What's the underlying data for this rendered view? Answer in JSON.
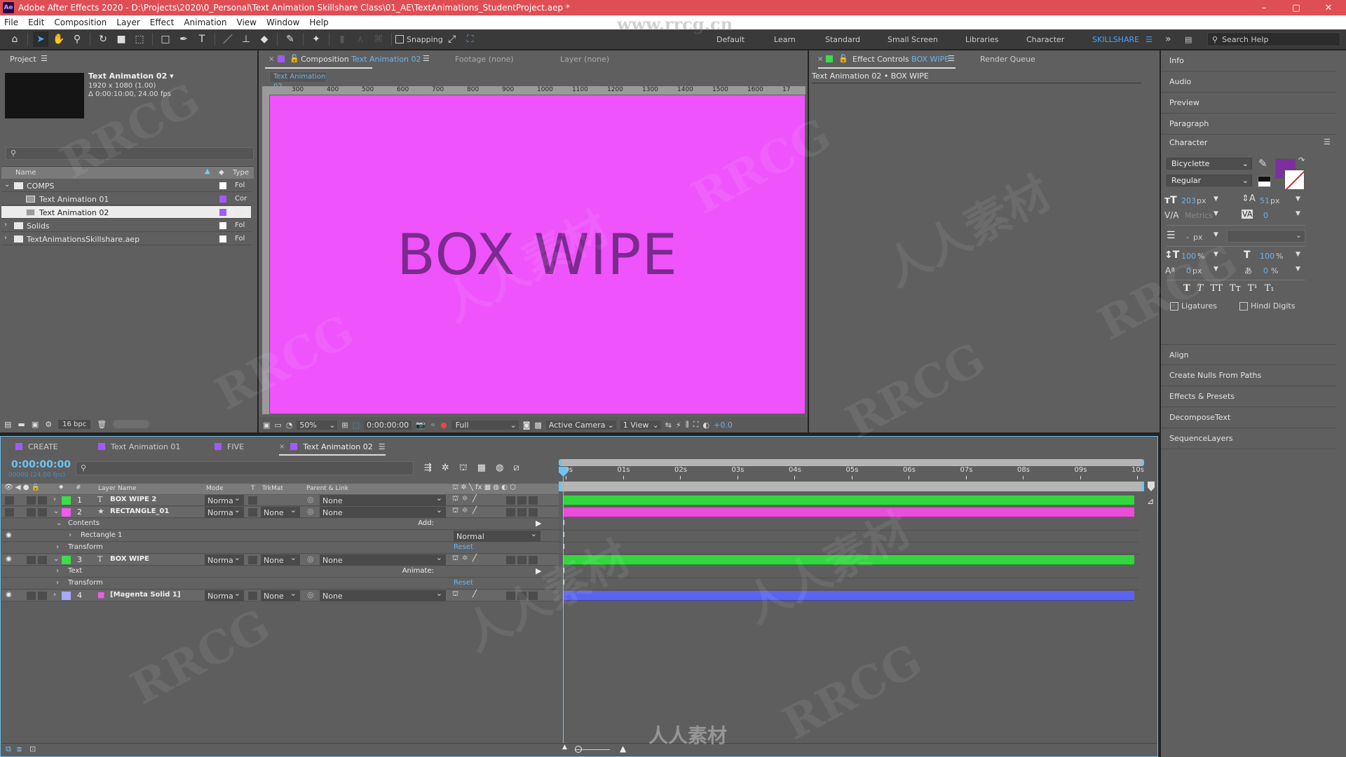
{
  "app": {
    "title": "Adobe After Effects 2020 - D:\\Projects\\2020\\0_Personal\\Text Animation Skillshare Class\\01_AE\\TextAnimations_StudentProject.aep *",
    "logo": "Ae",
    "window_controls": {
      "minimize": "–",
      "maximize": "▢",
      "close": "✕"
    }
  },
  "menu": [
    "File",
    "Edit",
    "Composition",
    "Layer",
    "Effect",
    "Animation",
    "View",
    "Window",
    "Help"
  ],
  "toolbar": {
    "tools": [
      "home-icon",
      "selection-tool",
      "hand-tool",
      "zoom-tool",
      "rotation-tool",
      "camera-tool",
      "pan-behind-tool",
      "rectangle-tool",
      "pen-tool",
      "type-tool",
      "brush-tool",
      "clone-stamp-tool",
      "eraser-tool",
      "roto-brush-tool",
      "puppet-tool"
    ],
    "snapping_label": "Snapping",
    "snapping_checked": false,
    "workspaces": [
      "Default",
      "Learn",
      "Standard",
      "Small Screen",
      "Libraries",
      "Character"
    ],
    "active_workspace": "SKILLSHARE",
    "overflow": "»",
    "search_placeholder": "Search Help"
  },
  "project": {
    "title": "Project",
    "selected_name": "Text Animation 02 ▾",
    "selected_size": "1920 x 1080 (1.00)",
    "selected_duration": "Δ 0:00:10:00, 24.00 fps",
    "search_placeholder": "",
    "columns": {
      "name": "Name",
      "type": "Type"
    },
    "items": [
      {
        "name": "COMPS",
        "type": "Fol",
        "kind": "folder",
        "expanded": true,
        "label_color": "#ffffff",
        "indent": 0
      },
      {
        "name": "Text Animation 01",
        "type": "Cor",
        "kind": "comp",
        "label_color": "#a259ff",
        "indent": 1
      },
      {
        "name": "Text Animation 02",
        "type": "Cor",
        "kind": "comp",
        "label_color": "#a259ff",
        "indent": 1,
        "selected": true
      },
      {
        "name": "Solids",
        "type": "Fol",
        "kind": "folder",
        "expanded": false,
        "label_color": "#ffffff",
        "indent": 0
      },
      {
        "name": "TextAnimationsSkillshare.aep",
        "type": "Fol",
        "kind": "folder",
        "expanded": false,
        "label_color": "#ffffff",
        "indent": 0
      }
    ],
    "bpc": "16 bpc"
  },
  "viewer": {
    "tabs": [
      {
        "prefix": "Composition",
        "name": "Text Animation 02",
        "active": true
      },
      {
        "prefix": "Footage",
        "name": "(none)"
      },
      {
        "prefix": "Layer",
        "name": "(none)"
      }
    ],
    "breadcrumb": "Text Animation 02",
    "ruler_ticks": [
      "300",
      "400",
      "500",
      "600",
      "700",
      "800",
      "900",
      "1000",
      "1100",
      "1200",
      "1300",
      "1400",
      "1500",
      "1600",
      "17"
    ],
    "canvas_text": "BOX WIPE",
    "canvas_bg": "#ef53fb",
    "text_color": "#7b2a8e",
    "footer": {
      "zoom": "50%",
      "timecode": "0:00:00:00",
      "resolution": "Full",
      "camera": "Active Camera",
      "views": "1 View",
      "exposure": "+0.0"
    }
  },
  "effect_controls": {
    "tabs": [
      {
        "prefix": "Effect Controls",
        "name": "BOX WIPE",
        "active": true
      },
      {
        "prefix": "Render Queue",
        "name": ""
      }
    ],
    "subtitle": "Text Animation 02 • BOX WIPE"
  },
  "right_panel": {
    "top_items": [
      "Info",
      "Audio",
      "Preview",
      "Paragraph"
    ],
    "character": {
      "title": "Character",
      "font": "Bicyclette",
      "style": "Regular",
      "fill_color": "#7d2fa0",
      "font_size": "203",
      "font_size_unit": "px",
      "leading": "51",
      "leading_unit": "px",
      "kerning": "Metrics",
      "tracking": "0",
      "stroke_width": "-",
      "stroke_unit": "px",
      "vertical_scale": "100",
      "horizontal_scale": "100",
      "baseline_shift": "0",
      "baseline_unit": "px",
      "tsume": "0",
      "percent": "%",
      "style_buttons": [
        "T",
        "T",
        "TT",
        "Tт",
        "T¹",
        "T₁"
      ],
      "ligatures_label": "Ligatures",
      "hindi_digits_label": "Hindi Digits"
    },
    "bottom_items": [
      "Align",
      "Create Nulls From Paths",
      "Effects & Presets",
      "DecomposeText",
      "SequenceLayers"
    ]
  },
  "timeline": {
    "tabs": [
      {
        "name": "CREATE",
        "color": "#a259ff"
      },
      {
        "name": "Text Animation 01",
        "color": "#a259ff"
      },
      {
        "name": "FIVE",
        "color": "#a259ff"
      },
      {
        "name": "Text Animation 02",
        "color": "#a259ff",
        "active": true
      }
    ],
    "current_time": "0:00:00:00",
    "frame_info": "00000 (24.00 fps)",
    "columns": {
      "layer_name": "Layer Name",
      "mode": "Mode",
      "t": "T",
      "trkmat": "TrkMat",
      "parent": "Parent & Link"
    },
    "ruler": [
      "00s",
      "01s",
      "02s",
      "03s",
      "04s",
      "05s",
      "06s",
      "07s",
      "08s",
      "09s",
      "10s"
    ],
    "duration_seconds": 10,
    "playhead_seconds": 0,
    "rows": [
      {
        "type": "layer",
        "num": "1",
        "icon": "T",
        "name": "BOX WIPE 2",
        "color": "#3ddc4a",
        "mode": "Norma",
        "trkmat": "",
        "parent": "None",
        "bar_color": "#33d63f",
        "visible": false,
        "twirl": ">"
      },
      {
        "type": "layer",
        "num": "2",
        "icon": "★",
        "name": "RECTANGLE_01",
        "color": "#f059f0",
        "mode": "Norma",
        "trkmat": "None",
        "parent": "None",
        "bar_color": "#e94ed8",
        "visible": false,
        "twirl": "v"
      },
      {
        "type": "prop",
        "indent": 1,
        "name": "Contents",
        "twirl": "v",
        "right": "Add:"
      },
      {
        "type": "prop",
        "indent": 2,
        "name": "Rectangle 1",
        "twirl": ">",
        "dropdown": "Normal",
        "visible": true
      },
      {
        "type": "prop",
        "indent": 1,
        "name": "Transform",
        "twirl": ">",
        "link": "Reset"
      },
      {
        "type": "layer",
        "num": "3",
        "icon": "T",
        "name": "BOX WIPE",
        "color": "#3ddc4a",
        "mode": "Norma",
        "trkmat": "None",
        "parent": "None",
        "bar_color": "#33d63f",
        "visible": true,
        "twirl": "v"
      },
      {
        "type": "prop",
        "indent": 1,
        "name": "Text",
        "twirl": ">",
        "right": "Animate:"
      },
      {
        "type": "prop",
        "indent": 1,
        "name": "Transform",
        "twirl": ">",
        "link": "Reset"
      },
      {
        "type": "layer",
        "num": "4",
        "icon": "■",
        "name": "[Magenta Solid 1]",
        "color": "#a6a9f5",
        "mode": "Norma",
        "trkmat": "None",
        "parent": "None",
        "bar_color": "#5a64f0",
        "visible": true,
        "twirl": ">"
      }
    ]
  },
  "watermark": {
    "url_text": "www.rrcg.cn",
    "brand": "RRCG",
    "cn": "人人素材"
  }
}
